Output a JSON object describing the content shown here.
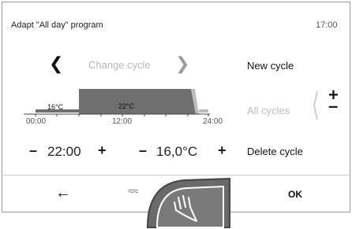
{
  "header": {
    "title": "Adapt \"All day\" program",
    "time": "17:00"
  },
  "cycle_nav": {
    "label": "Change cycle"
  },
  "menu": {
    "new_cycle": "New cycle",
    "all_cycles": "All cycles",
    "delete_cycle": "Delete cycle"
  },
  "schedule": {
    "times": [
      "00:00",
      "12:00",
      "24:00"
    ],
    "low_temp": "16°C",
    "high_temp": "22°C"
  },
  "controls": {
    "time_value": "22:00",
    "temp_value": "16,0°C"
  },
  "footer": {
    "ok": "OK"
  },
  "colors": {
    "bar": "#6f6f6f",
    "accent": "#6a6a6a"
  },
  "icons": [
    "chevron-left-icon",
    "chevron-right-icon",
    "plus-icon",
    "minus-icon",
    "back-arrow-icon",
    "heating-icon",
    "hand-touch-icon"
  ]
}
